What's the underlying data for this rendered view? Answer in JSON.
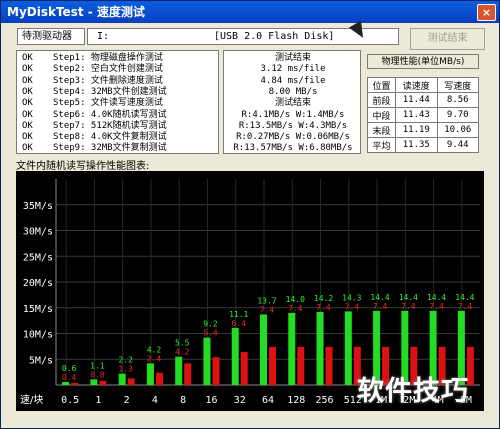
{
  "window": {
    "title": "MyDiskTest - 速度测试",
    "close_glyph": "×"
  },
  "top": {
    "drive_label": "待测驱动器",
    "drive_letter": "I:",
    "disk_name": "[USB 2.0 Flash Disk]",
    "finish_button": "测试结束"
  },
  "steps": [
    {
      "status": "OK",
      "label": "Step1: 物理磁盘操作测试"
    },
    {
      "status": "OK",
      "label": "Step2: 空白文件创建测试"
    },
    {
      "status": "OK",
      "label": "Step3: 文件删除速度测试"
    },
    {
      "status": "OK",
      "label": "Step4: 32MB文件创建测试"
    },
    {
      "status": "OK",
      "label": "Step5: 文件读写速度测试"
    },
    {
      "status": "OK",
      "label": "Step6: 4.0K随机读写测试"
    },
    {
      "status": "OK",
      "label": "Step7: 512K随机读写测试"
    },
    {
      "status": "OK",
      "label": "Step8: 4.0K文件复制测试"
    },
    {
      "status": "OK",
      "label": "Step9: 32MB文件复制测试"
    }
  ],
  "results": {
    "lines": [
      "测试结束",
      "3.12 ms/file",
      "4.84 ms/file",
      "8.00 MB/s",
      "测试结束",
      "R:4.1MB/s W:1.4MB/s",
      "R:13.5MB/s W:4.3MB/s",
      "R:0.27MB/s W:0.06MB/s",
      "R:13.57MB/s W:6.80MB/s"
    ]
  },
  "perf": {
    "title": "物理性能(单位MB/s)",
    "headers": [
      "位置",
      "读速度",
      "写速度"
    ],
    "rows": [
      [
        "前段",
        "11.44",
        "8.56"
      ],
      [
        "中段",
        "11.43",
        "9.70"
      ],
      [
        "末段",
        "11.19",
        "10.06"
      ],
      [
        "平均",
        "11.35",
        "9.44"
      ]
    ]
  },
  "chart_label": "文件内随机读写操作性能图表:",
  "watermark": "软件技巧",
  "chart_data": {
    "type": "bar",
    "title": "文件内随机读写操作性能图表:",
    "xlabel": "速/块",
    "ylabel": "",
    "ylim": [
      0,
      40
    ],
    "yticks": [
      "5M/s",
      "10M/s",
      "15M/s",
      "20M/s",
      "25M/s",
      "30M/s",
      "35M/s"
    ],
    "categories": [
      "0.5",
      "1",
      "2",
      "4",
      "8",
      "16",
      "32",
      "64",
      "128",
      "256",
      "512",
      "1M",
      "2M",
      "4M",
      "8M"
    ],
    "read_labels": [
      "0.6",
      "1.1",
      "2.2",
      "4.2",
      "5.5",
      "9.2",
      "11.1",
      "13.7",
      "14.0",
      "14.2",
      "14.3",
      "14.4",
      "14.4",
      "14.4",
      "14.4"
    ],
    "write_labels": [
      "0.4",
      "0.8",
      "1.3",
      "2.4",
      "4.2",
      "5.4",
      "6.4",
      "7.4",
      "7.4",
      "7.4",
      "7.4",
      "7.4",
      "7.4",
      "7.4",
      "7.4"
    ],
    "series": [
      {
        "values": [
          0.6,
          1.1,
          2.2,
          4.2,
          5.5,
          9.2,
          11.1,
          13.7,
          14.0,
          14.2,
          14.3,
          14.4,
          14.4,
          14.4,
          14.4
        ],
        "color": "#22dd22"
      },
      {
        "values": [
          0.4,
          0.8,
          1.3,
          2.4,
          4.2,
          5.4,
          6.4,
          7.4,
          7.4,
          7.4,
          7.4,
          7.4,
          7.4,
          7.4,
          7.4
        ],
        "color": "#dd1111"
      }
    ],
    "grid": true
  }
}
